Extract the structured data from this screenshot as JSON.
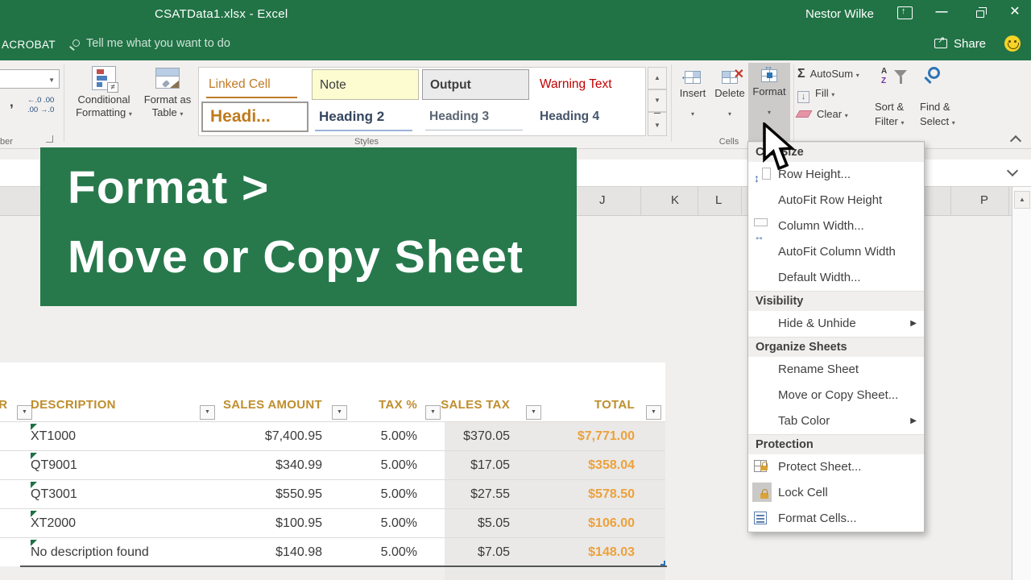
{
  "colors": {
    "excel_green": "#217346",
    "banner_green": "#27794c",
    "header_gold": "#bf8e2d",
    "total_orange": "#eda13a"
  },
  "titlebar": {
    "title": "CSATData1.xlsx  -  Excel",
    "user": "Nestor Wilke"
  },
  "tabstrip": {
    "acrobat_tab": "ACROBAT",
    "tell_me": "Tell me what you want to do",
    "share": "Share"
  },
  "ribbon": {
    "number_group": {
      "label": "ber",
      "comma": ",",
      "inc_decimal": "←.0 .00",
      "dec_decimal": ".00 →.0"
    },
    "conditional_formatting": {
      "line1": "Conditional",
      "line2": "Formatting"
    },
    "format_as_table": {
      "line1": "Format as",
      "line2": "Table"
    },
    "styles": {
      "group_label": "Styles",
      "items": [
        {
          "label": "Linked Cell"
        },
        {
          "label": "Note"
        },
        {
          "label": "Output"
        },
        {
          "label": "Warning Text"
        },
        {
          "label": "Headi..."
        },
        {
          "label": "Heading 2"
        },
        {
          "label": "Heading 3"
        },
        {
          "label": "Heading 4"
        }
      ]
    },
    "cells_group": {
      "group_label": "Cells",
      "insert": "Insert",
      "delete": "Delete",
      "format": "Format"
    },
    "editing_group": {
      "autosum": "AutoSum",
      "fill": "Fill",
      "clear": "Clear",
      "sort_line1": "Sort &",
      "sort_line2": "Filter",
      "find_line1": "Find &",
      "find_line2": "Select"
    }
  },
  "banner": {
    "line1": "Format >",
    "line2": "Move or Copy Sheet"
  },
  "format_menu": {
    "sections": [
      {
        "header": "Cell Size",
        "items": [
          {
            "label": "Row Height...",
            "icon": "row-height"
          },
          {
            "label": "AutoFit Row Height"
          },
          {
            "label": "Column Width...",
            "icon": "column-width"
          },
          {
            "label": "AutoFit Column Width"
          },
          {
            "label": "Default Width..."
          }
        ]
      },
      {
        "header": "Visibility",
        "items": [
          {
            "label": "Hide & Unhide",
            "submenu": true
          }
        ]
      },
      {
        "header": "Organize Sheets",
        "items": [
          {
            "label": "Rename Sheet"
          },
          {
            "label": "Move or Copy Sheet..."
          },
          {
            "label": "Tab Color",
            "submenu": true
          }
        ]
      },
      {
        "header": "Protection",
        "items": [
          {
            "label": "Protect Sheet...",
            "icon": "protect-sheet"
          },
          {
            "label": "Lock Cell",
            "icon": "lock-cell"
          },
          {
            "label": "Format Cells...",
            "icon": "format-cells"
          }
        ]
      }
    ]
  },
  "sheet": {
    "col_letters": [
      "J",
      "K",
      "L",
      "P"
    ]
  },
  "table": {
    "headers": [
      "ER",
      "DESCRIPTION",
      "SALES AMOUNT",
      "TAX %",
      "SALES TAX",
      "TOTAL"
    ],
    "rows": [
      {
        "description": "XT1000",
        "sales_amount": "$7,400.95",
        "tax_pct": "5.00%",
        "sales_tax": "$370.05",
        "total": "$7,771.00"
      },
      {
        "description": "QT9001",
        "sales_amount": "$340.99",
        "tax_pct": "5.00%",
        "sales_tax": "$17.05",
        "total": "$358.04"
      },
      {
        "description": "QT3001",
        "sales_amount": "$550.95",
        "tax_pct": "5.00%",
        "sales_tax": "$27.55",
        "total": "$578.50"
      },
      {
        "description": "XT2000",
        "sales_amount": "$100.95",
        "tax_pct": "5.00%",
        "sales_tax": "$5.05",
        "total": "$106.00"
      },
      {
        "description": "No description found",
        "sales_amount": "$140.98",
        "tax_pct": "5.00%",
        "sales_tax": "$7.05",
        "total": "$148.03"
      }
    ]
  }
}
